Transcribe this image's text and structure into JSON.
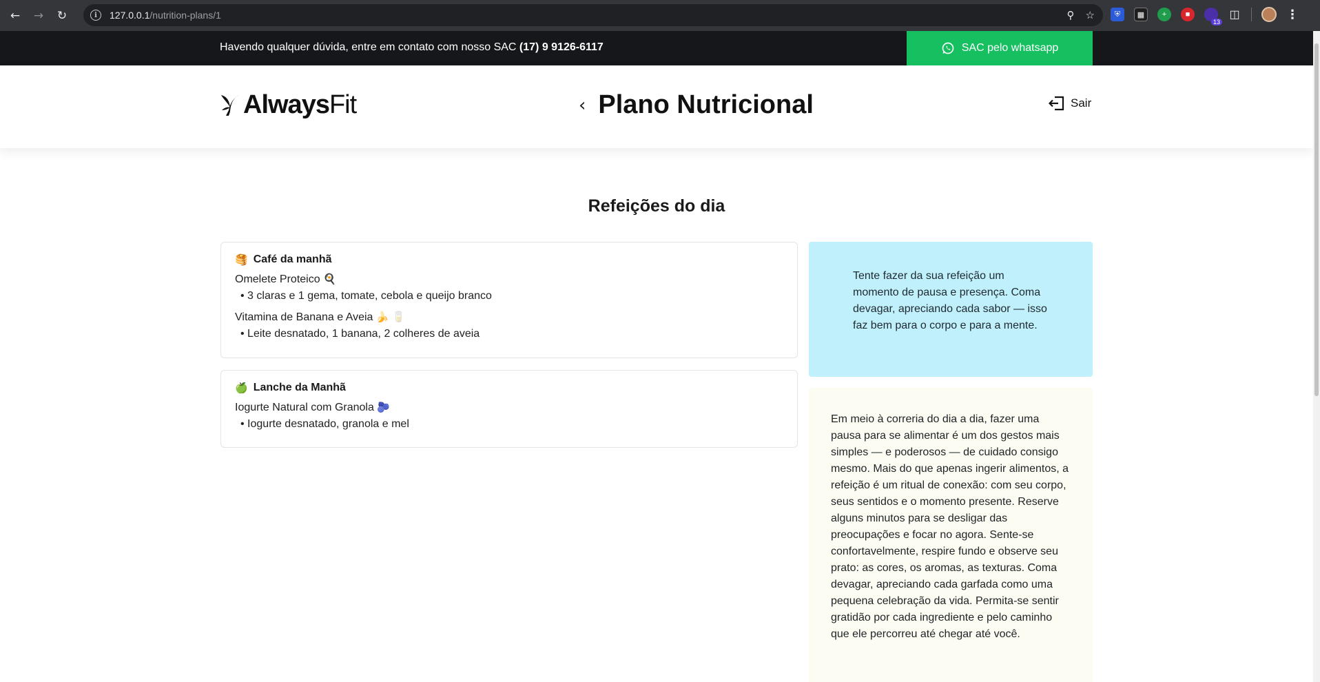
{
  "browser": {
    "url_host": "127.0.0.1",
    "url_path": "/nutrition-plans/1",
    "ext_badge_count": "13"
  },
  "topbar": {
    "message": "Havendo qualquer dúvida, entre em contato com nosso SAC ",
    "phone": "(17) 9 9126-6117",
    "whatsapp_label": "SAC pelo whatsapp"
  },
  "header": {
    "logo_bold": "Always",
    "logo_light": "Fit",
    "title": "Plano Nutricional",
    "logout_label": "Sair"
  },
  "section_title": "Refeições do dia",
  "meals": [
    {
      "emoji": "🥞",
      "title": "Café da manhã",
      "items": [
        {
          "name": "Omelete Proteico",
          "emoji": "🍳",
          "desc": "• 3 claras e 1 gema, tomate, cebola e queijo branco"
        },
        {
          "name": "Vitamina de Banana e Aveia",
          "emoji": "🍌 🥛",
          "desc": "• Leite desnatado, 1 banana, 2 colheres de aveia"
        }
      ]
    },
    {
      "emoji": "🍏",
      "title": "Lanche da Manhã",
      "items": [
        {
          "name": "Iogurte Natural com Granola",
          "emoji": "🫐",
          "desc": "• Iogurte desnatado, granola e mel"
        }
      ]
    }
  ],
  "tip": "Tente fazer da sua refeição um momento de pausa e presença. Coma devagar, apreciando cada sabor — isso faz bem para o corpo e para a mente.",
  "reflection": "Em meio à correria do dia a dia, fazer uma pausa para se alimentar é um dos gestos mais simples — e poderosos — de cuidado consigo mesmo. Mais do que apenas ingerir alimentos, a refeição é um ritual de conexão: com seu corpo, seus sentidos e o momento presente. Reserve alguns minutos para se desligar das preocupações e focar no agora. Sente-se confortavelmente, respire fundo e observe seu prato: as cores, os aromas, as texturas. Coma devagar, apreciando cada garfada como uma pequena celebração da vida. Permita-se sentir gratidão por cada ingrediente e pelo caminho que ele percorreu até chegar até você.",
  "colors": {
    "topbar_bg": "#16171b",
    "whatsapp_green": "#16c060",
    "tip_bg": "#bff0fb",
    "reflection_bg": "#fdfcf3"
  }
}
